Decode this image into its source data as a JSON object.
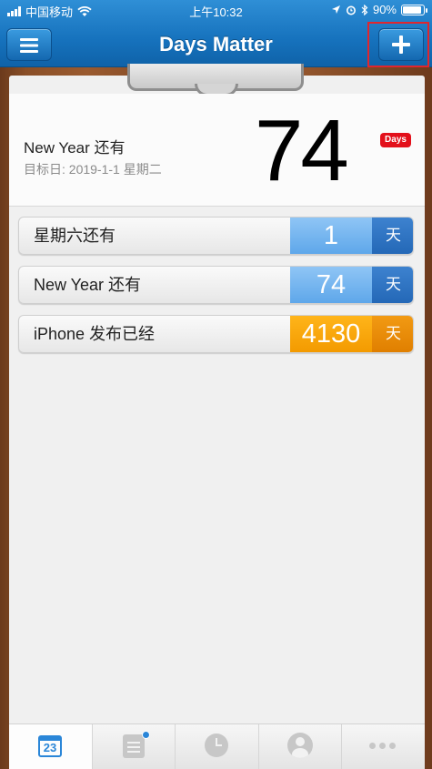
{
  "status_bar": {
    "carrier": "中国移动",
    "time": "上午10:32",
    "battery": "90%",
    "battery_level": 0.9
  },
  "header": {
    "title": "Days Matter",
    "menu_icon": "hamburger-icon",
    "add_icon": "plus-icon"
  },
  "featured": {
    "name": "New Year 还有",
    "target_date": "目标日: 2019-1-1 星期二",
    "count": "74",
    "badge": "Days"
  },
  "events": [
    {
      "label": "星期六还有",
      "count": "1",
      "unit": "天",
      "color": "blue"
    },
    {
      "label": "New Year 还有",
      "count": "74",
      "unit": "天",
      "color": "blue"
    },
    {
      "label": "iPhone 发布已经",
      "count": "4130",
      "unit": "天",
      "color": "orange"
    }
  ],
  "tabbar": {
    "calendar_day": "23",
    "tabs": [
      "calendar-icon",
      "list-icon",
      "clock-icon",
      "user-icon",
      "more-icon"
    ]
  },
  "colors": {
    "header_blue": "#1672bd",
    "countup_blue": "#5ea7ea",
    "countdown_orange": "#f39a00",
    "badge_red": "#e3101b",
    "highlight_red": "#e0262e"
  }
}
